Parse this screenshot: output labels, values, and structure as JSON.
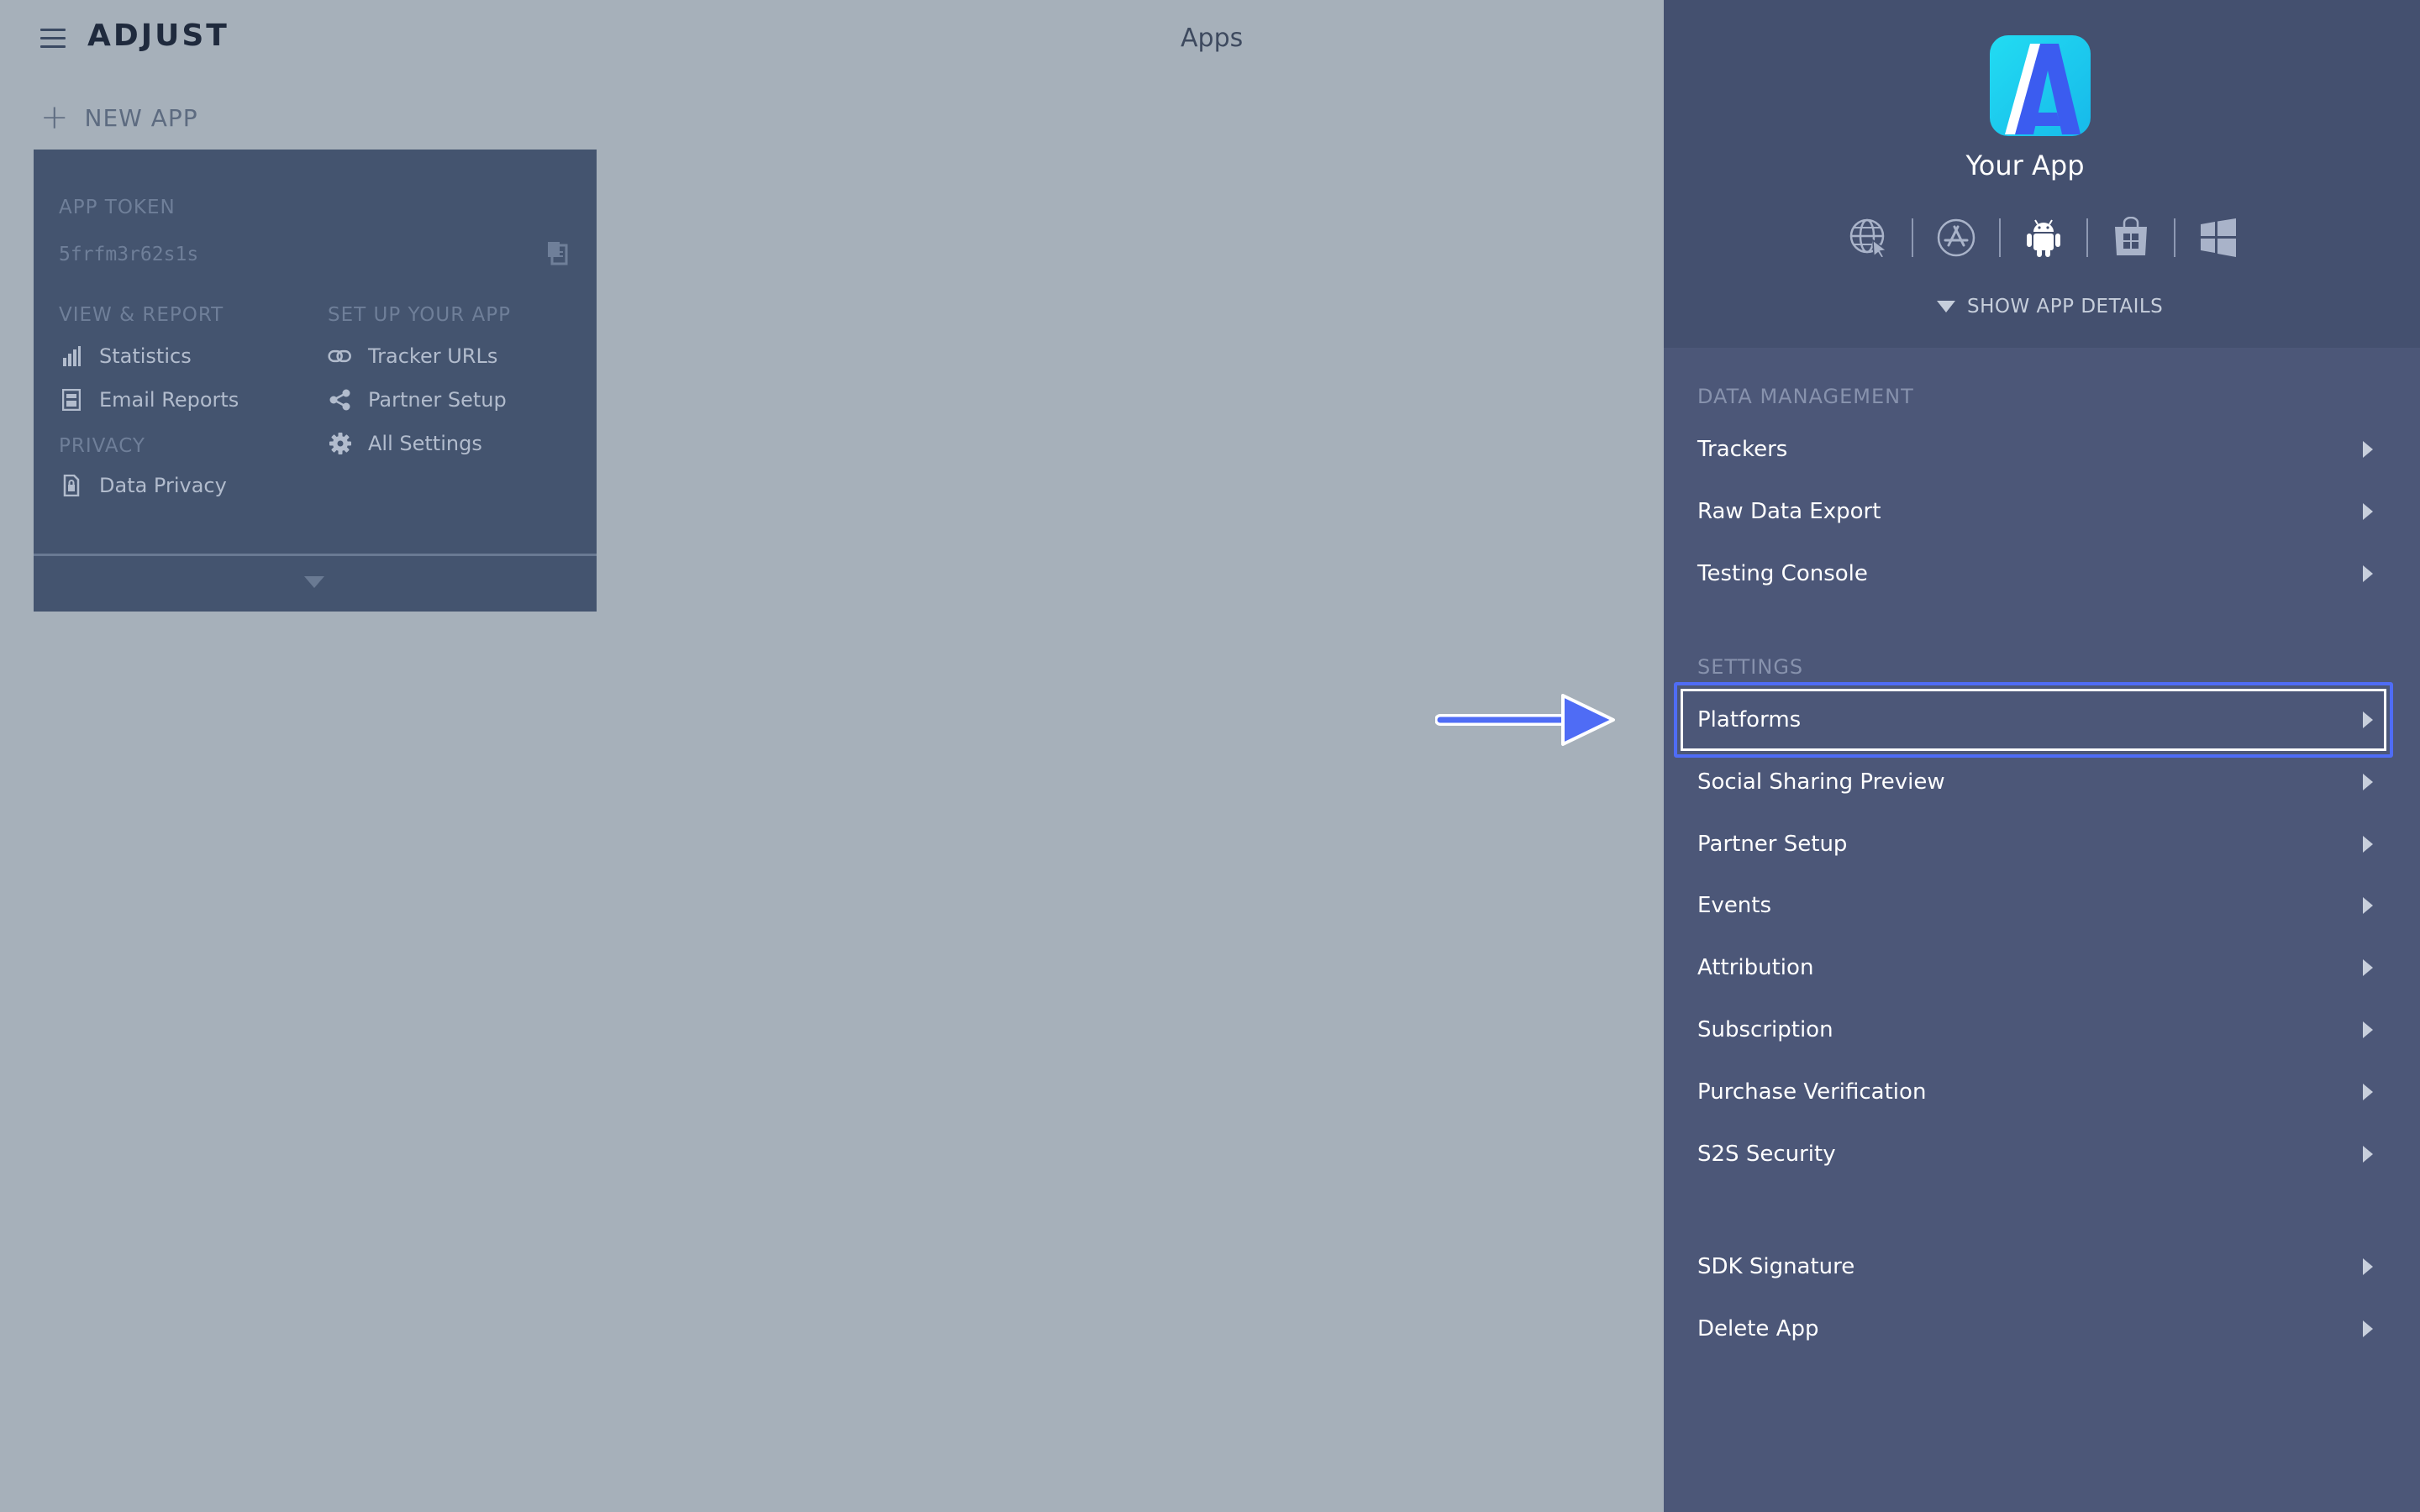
{
  "header": {
    "logo": "ADJUST",
    "page_title": "Apps"
  },
  "new_app": {
    "label": "NEW APP"
  },
  "app_card": {
    "token_label": "APP TOKEN",
    "token_value": "5frfm3r62s1s",
    "view_report": {
      "heading": "VIEW & REPORT",
      "items": [
        {
          "label": "Statistics",
          "icon": "bar-chart-icon"
        },
        {
          "label": "Email Reports",
          "icon": "email-report-icon"
        }
      ]
    },
    "privacy": {
      "heading": "PRIVACY",
      "items": [
        {
          "label": "Data Privacy",
          "icon": "document-lock-icon"
        }
      ]
    },
    "setup": {
      "heading": "SET UP YOUR APP",
      "items": [
        {
          "label": "Tracker URLs",
          "icon": "link-icon"
        },
        {
          "label": "Partner Setup",
          "icon": "share-icon"
        },
        {
          "label": "All Settings",
          "icon": "gear-icon"
        }
      ]
    }
  },
  "panel": {
    "app_name": "Your App",
    "platform_icons": [
      "web-icon",
      "app-store-icon",
      "android-icon",
      "windows-store-icon",
      "windows-icon"
    ],
    "show_details": "SHOW APP DETAILS",
    "data_management": {
      "heading": "DATA MANAGEMENT",
      "items": [
        "Trackers",
        "Raw Data Export",
        "Testing Console"
      ]
    },
    "settings": {
      "heading": "SETTINGS",
      "items": [
        "Platforms",
        "Social Sharing Preview",
        "Partner Setup",
        "Events",
        "Attribution",
        "Subscription",
        "Purchase Verification",
        "S2S Security"
      ]
    },
    "other": {
      "items": [
        "SDK Signature",
        "Delete App"
      ]
    },
    "highlighted_item": "Platforms"
  },
  "colors": {
    "background": "#a6b0ba",
    "card": "#44546f",
    "panel": "#4c5778",
    "panel_header": "#44506f",
    "highlight": "#4f6cf5",
    "app_icon_gradient": [
      "#1fd6f0",
      "#3b5cf0"
    ]
  }
}
